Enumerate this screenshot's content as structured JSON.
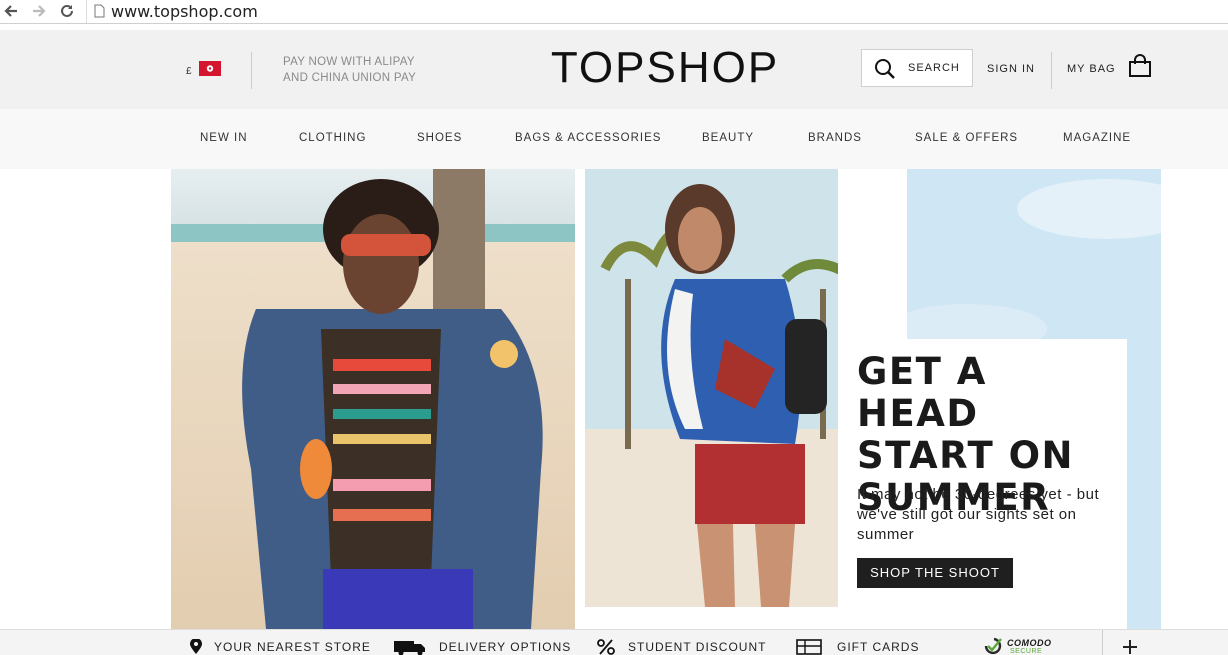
{
  "browser": {
    "url": "www.topshop.com"
  },
  "header": {
    "currency": "£",
    "promo_line1": "PAY NOW WITH ALIPAY",
    "promo_line2": "AND CHINA UNION PAY",
    "logo": "TOPSHOP",
    "search_label": "SEARCH",
    "signin_label": "SIGN IN",
    "bag_label": "MY BAG"
  },
  "nav": {
    "items": [
      "NEW IN",
      "CLOTHING",
      "SHOES",
      "BAGS & ACCESSORIES",
      "BEAUTY",
      "BRANDS",
      "SALE & OFFERS",
      "MAGAZINE"
    ]
  },
  "hero": {
    "title": "GET A HEAD START ON SUMMER",
    "body": "It may not be 30-degrees yet - but we've still got our sights set on summer",
    "cta": "SHOP THE SHOOT"
  },
  "footer": {
    "items": [
      "YOUR NEAREST STORE",
      "DELIVERY OPTIONS",
      "STUDENT DISCOUNT",
      "GIFT CARDS"
    ],
    "badge": "COMODO",
    "badge_sub": "SECURE",
    "expand_icon": "plus-icon"
  },
  "colors": {
    "header_bg": "#f1f1f1",
    "flag_red": "#d3162e",
    "button_dark": "#1f1f1f",
    "sky": "#cfe6f4"
  }
}
